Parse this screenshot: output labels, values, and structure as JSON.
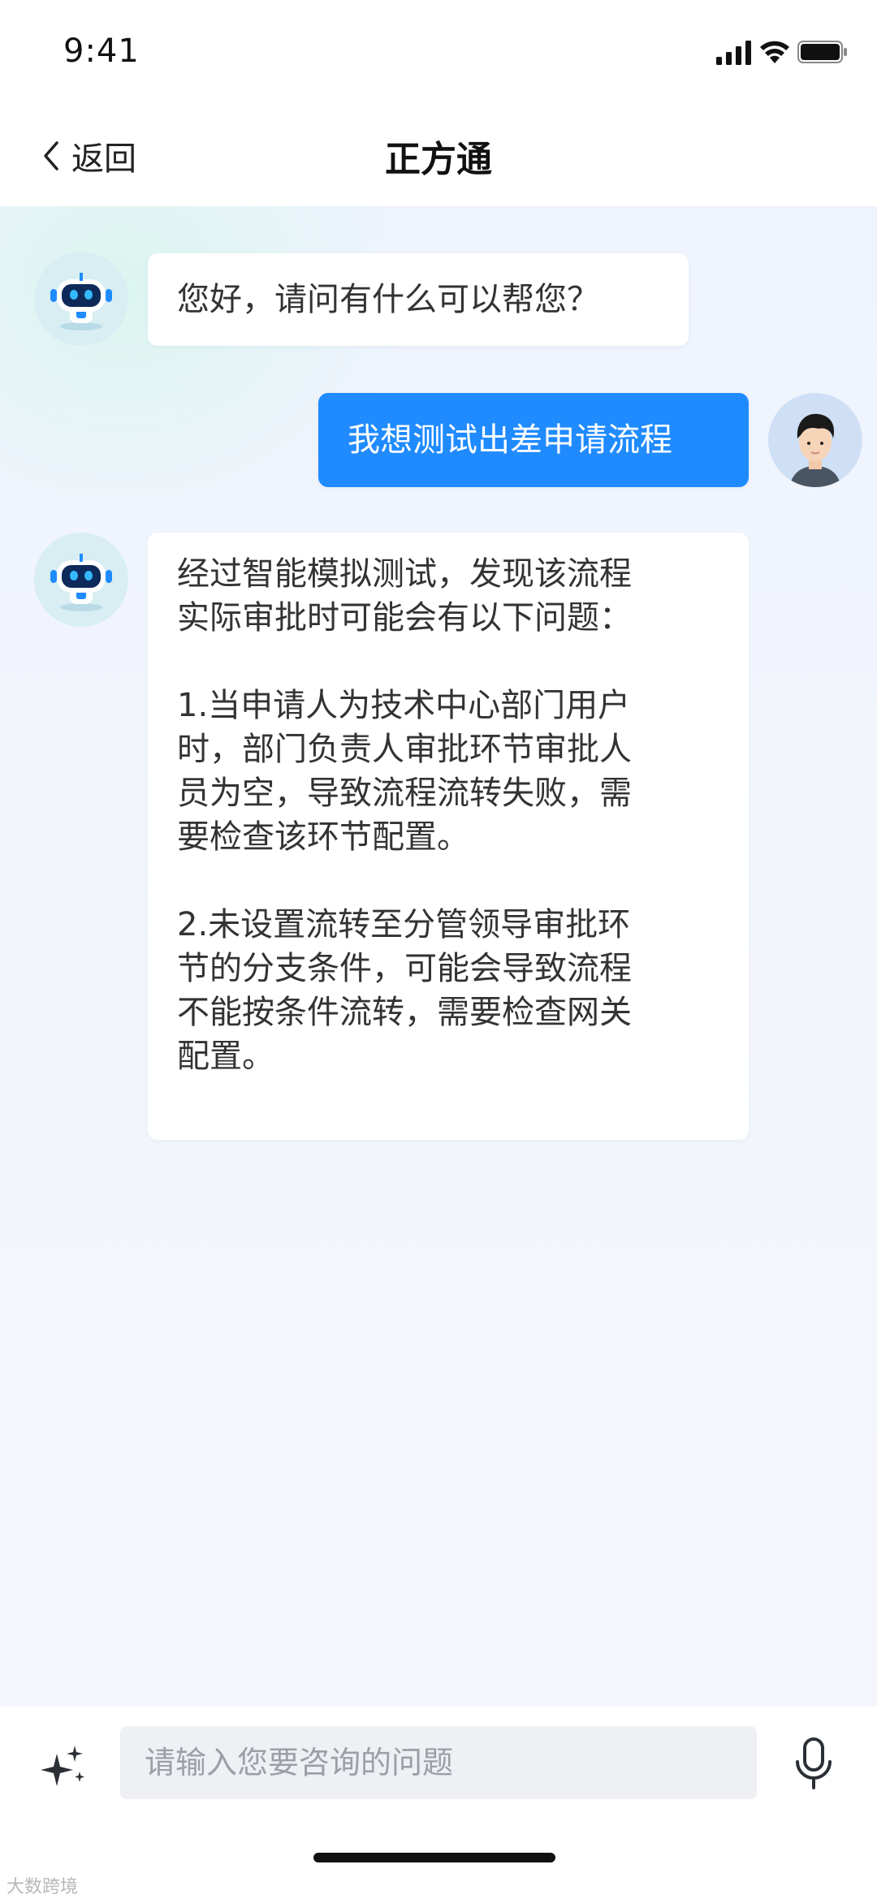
{
  "status_bar": {
    "time": "9:41",
    "icons": [
      "signal-icon",
      "wifi-icon",
      "battery-icon"
    ]
  },
  "header": {
    "back_label": "返回",
    "title": "正方通"
  },
  "messages": [
    {
      "sender": "bot",
      "avatar": "robot-avatar",
      "lines": [
        "您好，请问有什么可以帮您？"
      ]
    },
    {
      "sender": "user",
      "avatar": "user-avatar",
      "lines": [
        "我想测试出差申请流程"
      ]
    },
    {
      "sender": "bot",
      "avatar": "robot-avatar",
      "lines": [
        "经过智能模拟测试，发现该流程",
        "实际审批时可能会有以下问题：",
        "",
        "1.当申请人为技术中心部门用户",
        "时，部门负责人审批环节审批人",
        "员为空，导致流程流转失败，需",
        "要检查该环节配置。",
        "",
        "2.未设置流转至分管领导审批环",
        "节的分支条件，可能会导致流程",
        "不能按条件流转，需要检查网关",
        "配置。"
      ]
    }
  ],
  "input": {
    "placeholder": "请输入您要咨询的问题",
    "value": ""
  },
  "watermark": "大数跨境",
  "colors": {
    "accent": "#1f8bff",
    "chat_bg": "#f2f5fc",
    "bubble_bg": "#ffffff",
    "text": "#333333"
  }
}
